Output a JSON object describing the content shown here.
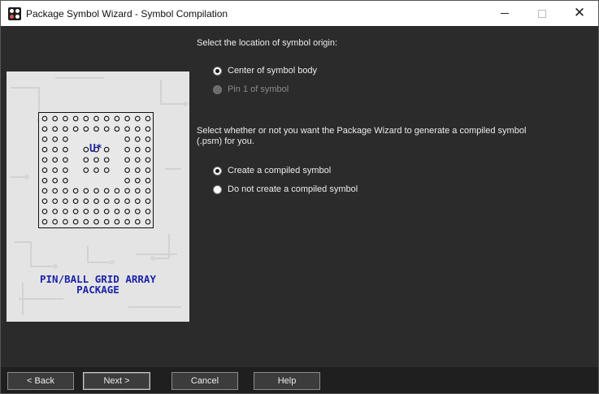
{
  "window": {
    "title": "Package Symbol Wizard - Symbol Compilation",
    "icon": "wizard-app-icon",
    "controls": [
      "minimize-icon",
      "maximize-icon",
      "close-icon"
    ]
  },
  "illustration": {
    "ref_designator": "U*",
    "caption_line1": "PIN/BALL GRID ARRAY",
    "caption_line2": "PACKAGE",
    "caption_color": "#1d23a8",
    "background_color": "#e4e4e4"
  },
  "origin_question": {
    "label": "Select the location of symbol origin:",
    "options": [
      {
        "label": "Center of symbol body",
        "selected": true,
        "enabled": true
      },
      {
        "label": "Pin 1 of symbol",
        "selected": false,
        "enabled": false
      }
    ]
  },
  "compile_question": {
    "label": "Select whether or not you want the Package Wizard to generate a compiled symbol (.psm) for you.",
    "options": [
      {
        "label": "Create a compiled symbol",
        "selected": true,
        "enabled": true
      },
      {
        "label": "Do not create a compiled symbol",
        "selected": false,
        "enabled": true
      }
    ]
  },
  "buttons": {
    "back": "< Back",
    "next": "Next >",
    "cancel": "Cancel",
    "help": "Help"
  },
  "colors": {
    "dialog_background": "#2b2b2b",
    "footer_background": "#1f1f1f",
    "button_background": "#3c3c3c",
    "text": "#ececec"
  }
}
